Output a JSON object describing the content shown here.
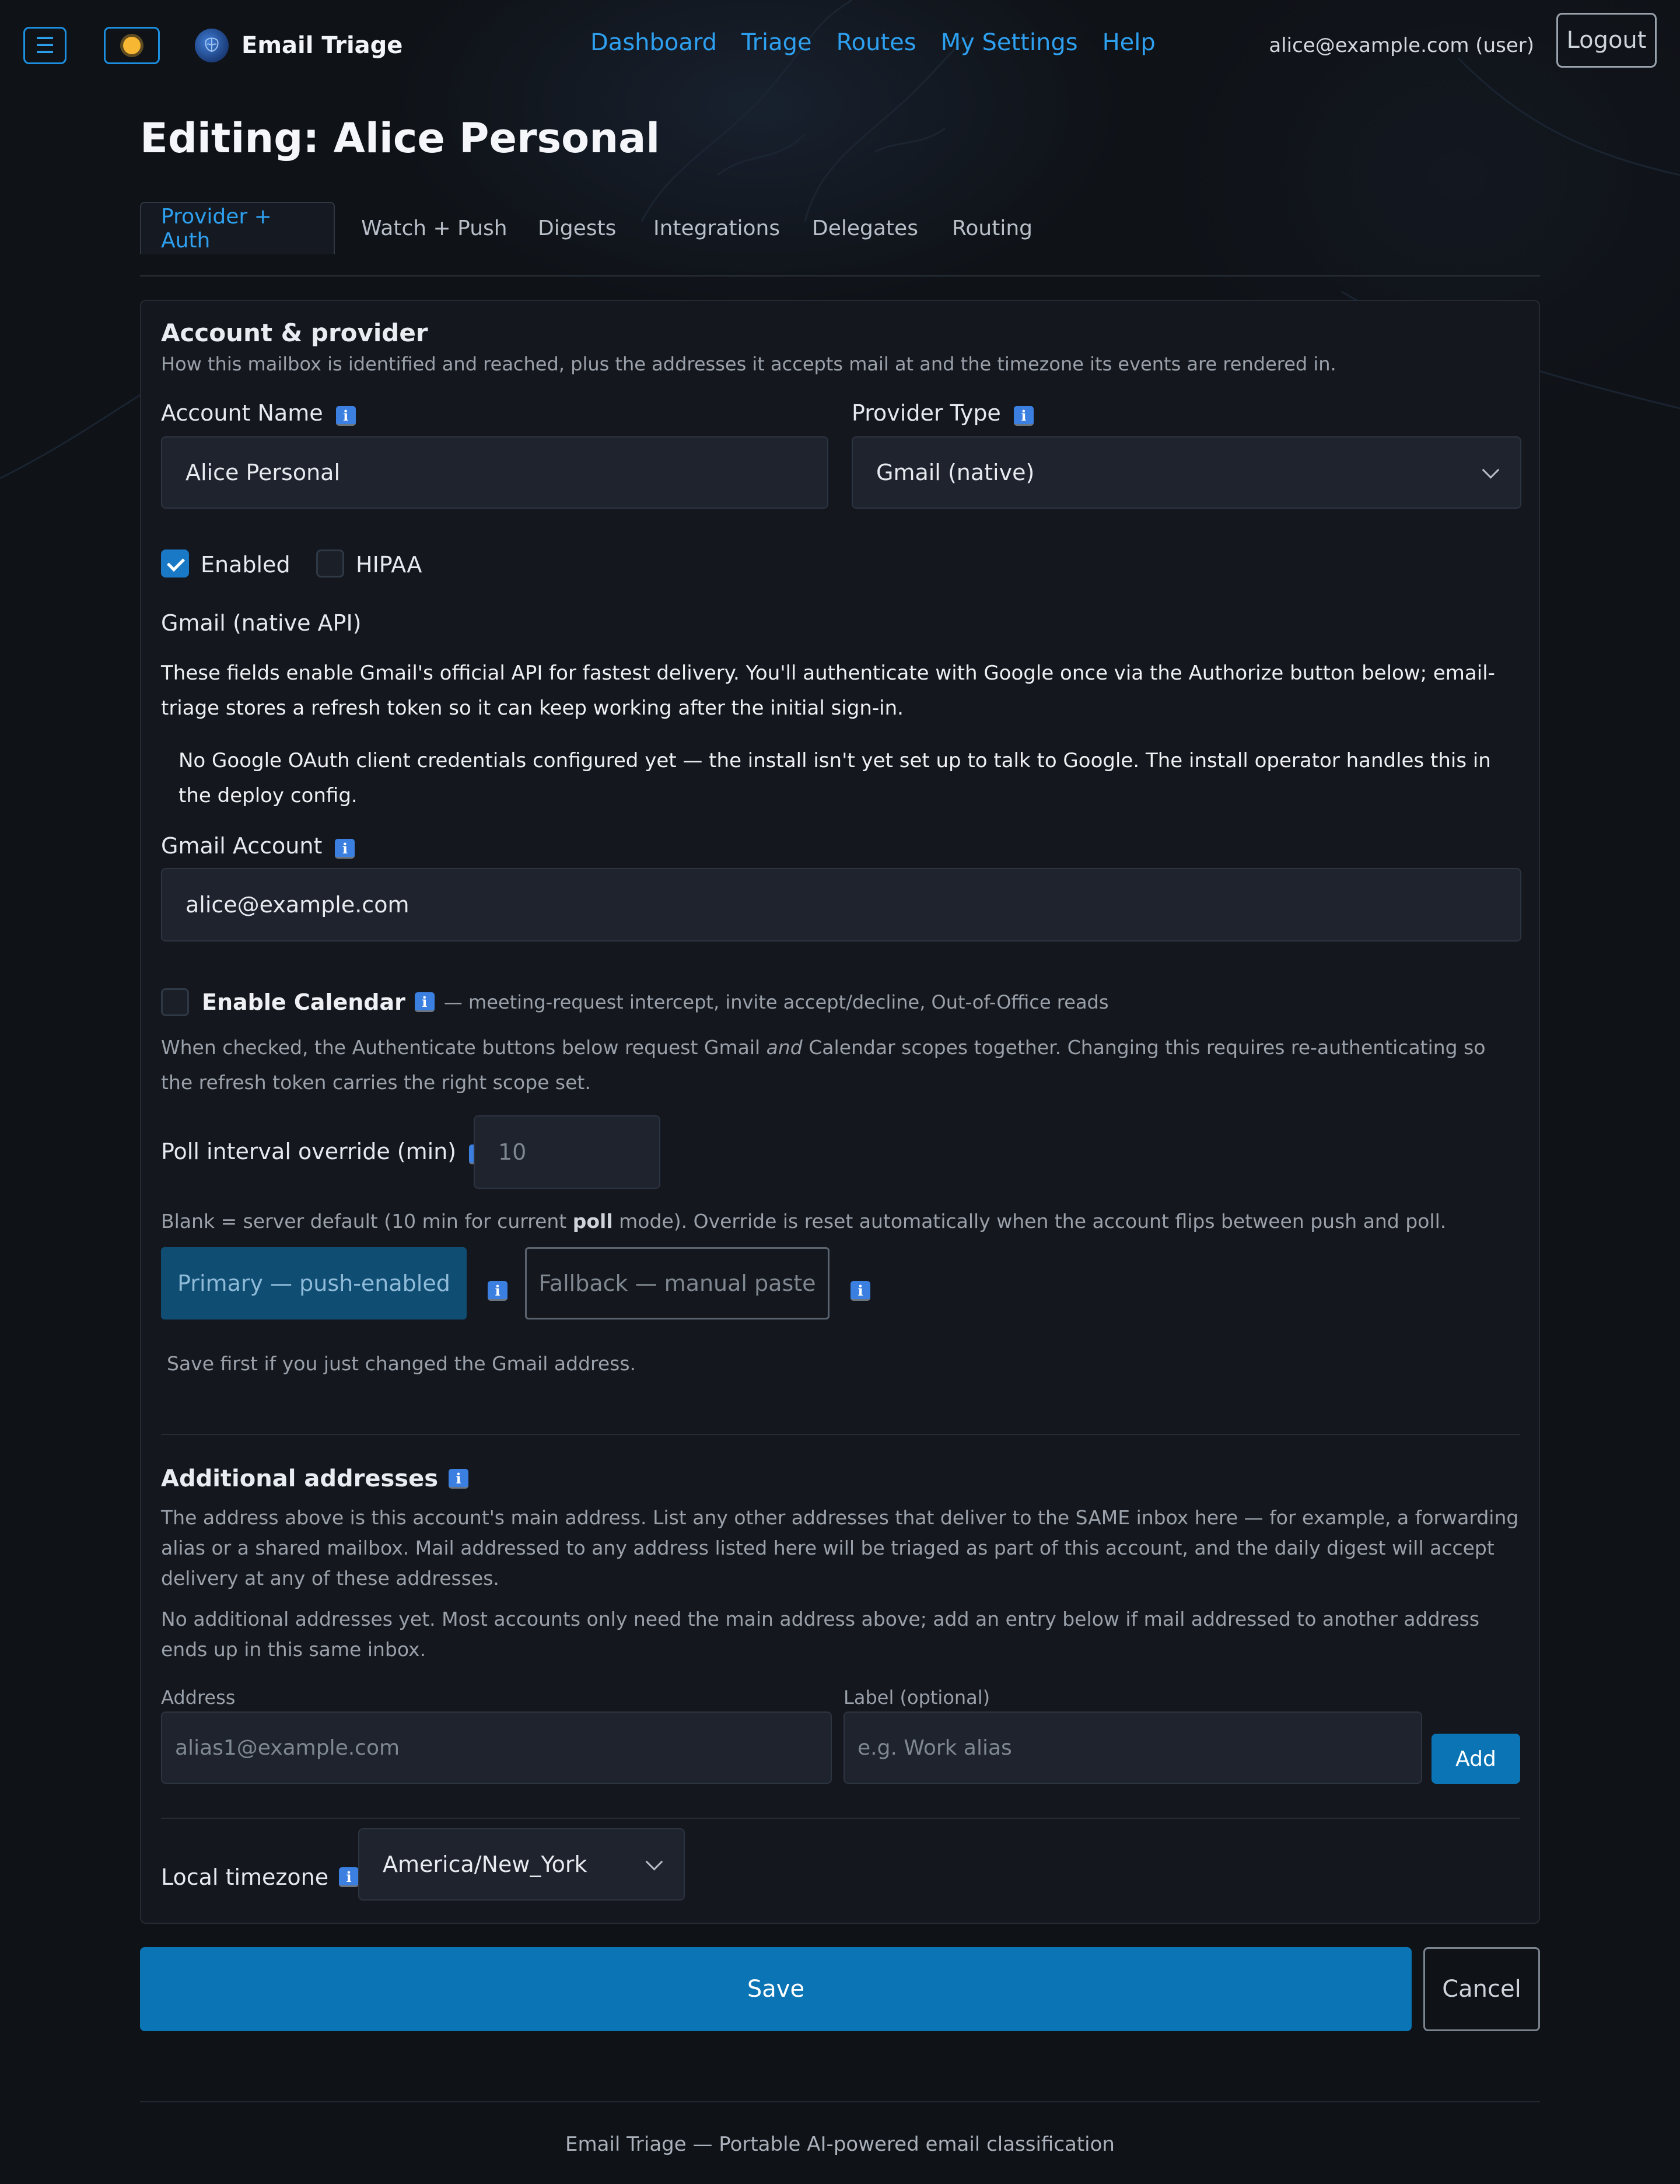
{
  "nav": {
    "menu_icon": "hamburger-icon",
    "theme_icon": "sun-icon",
    "brand_icon": "brain-icon",
    "brand": "Email Triage",
    "links": [
      "Dashboard",
      "Triage",
      "Routes",
      "My Settings",
      "Help"
    ],
    "user": "alice@example.com (user)",
    "logout": "Logout"
  },
  "page_title": "Editing: Alice Personal",
  "tabs": [
    "Provider + Auth",
    "Watch + Push",
    "Digests",
    "Integrations",
    "Delegates",
    "Routing"
  ],
  "account": {
    "title": "Account & provider",
    "description": "How this mailbox is identified and reached, plus the addresses it accepts mail at and the timezone its events are rendered in.",
    "account_name_label": "Account Name",
    "account_name_value": "Alice Personal",
    "provider_type_label": "Provider Type",
    "provider_type_value": "Gmail (native)",
    "enabled_label": "Enabled",
    "enabled_checked": true,
    "hipaa_label": "HIPAA",
    "hipaa_checked": false
  },
  "gmail": {
    "heading": "Gmail (native API)",
    "description": "These fields enable Gmail's official API for fastest delivery. You'll authenticate with Google once via the Authorize button below; email-triage stores a refresh token so it can keep working after the initial sign-in.",
    "notice": "No Google OAuth client credentials configured yet — the install isn't yet set up to talk to Google. The install operator handles this in the deploy config.",
    "account_label": "Gmail Account",
    "account_value": "alice@example.com",
    "calendar_label": "Enable Calendar",
    "calendar_hint": "— meeting-request intercept, invite accept/decline, Out-of-Office reads",
    "calendar_note_1": "When checked, the Authenticate buttons below request Gmail",
    "calendar_note_em": "and",
    "calendar_note_2": "Calendar scopes together. Changing this requires re-authenticating so the refresh token carries the right scope set.",
    "poll_label": "Poll interval override (min)",
    "poll_placeholder": "10",
    "poll_note_1": "Blank = server default (10 min for current",
    "poll_note_bold": "poll",
    "poll_note_2": "mode). Override is reset automatically when the account flips between push and poll.",
    "primary_button": "Primary — push-enabled",
    "fallback_button": "Fallback — manual paste",
    "save_note": "Save first if you just changed the Gmail address."
  },
  "additional": {
    "title": "Additional addresses",
    "description": "The address above is this account's main address. List any other addresses that deliver to the SAME inbox here — for example, a forwarding alias or a shared mailbox. Mail addressed to any address listed here will be triaged as part of this account, and the daily digest will accept delivery at any of these addresses.",
    "empty_note": "No additional addresses yet. Most accounts only need the main address above; add an entry below if mail addressed to another address ends up in this same inbox.",
    "address_label": "Address",
    "address_placeholder": "alias1@example.com",
    "label_label": "Label (optional)",
    "label_placeholder": "e.g. Work alias",
    "add_button": "Add"
  },
  "timezone": {
    "label": "Local timezone",
    "value": "America/New_York"
  },
  "info_icon": "info-icon",
  "actions": {
    "save": "Save",
    "cancel": "Cancel"
  },
  "footer": "Email Triage — Portable AI-powered email classification"
}
